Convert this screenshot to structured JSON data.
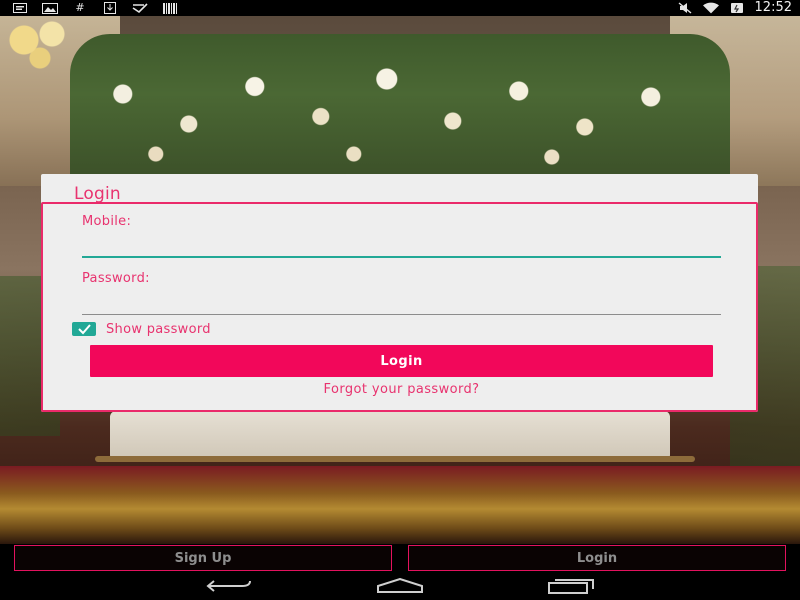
{
  "status_bar": {
    "time": "12:52",
    "left_icons": [
      "message-icon",
      "image-icon",
      "hashtag-icon",
      "download-icon",
      "check-icon",
      "barcode-icon"
    ],
    "right_icons": [
      "mute-icon",
      "wifi-icon",
      "battery-icon"
    ]
  },
  "login_dialog": {
    "title": "Login",
    "mobile": {
      "label": "Mobile:",
      "value": "",
      "placeholder": ""
    },
    "password": {
      "label": "Password:",
      "value": "",
      "placeholder": ""
    },
    "show_password": {
      "label": "Show password",
      "checked": true
    },
    "login_button": "Login",
    "forgot_link": "Forgot your password?"
  },
  "bottom_buttons": {
    "sign_up": "Sign Up",
    "login": "Login"
  },
  "colors": {
    "accent": "#f2075a",
    "text_pink": "#e8336f",
    "teal": "#21a896",
    "card_bg": "#eeeeee"
  },
  "nav_bar": [
    "back-icon",
    "home-icon",
    "recents-icon"
  ]
}
